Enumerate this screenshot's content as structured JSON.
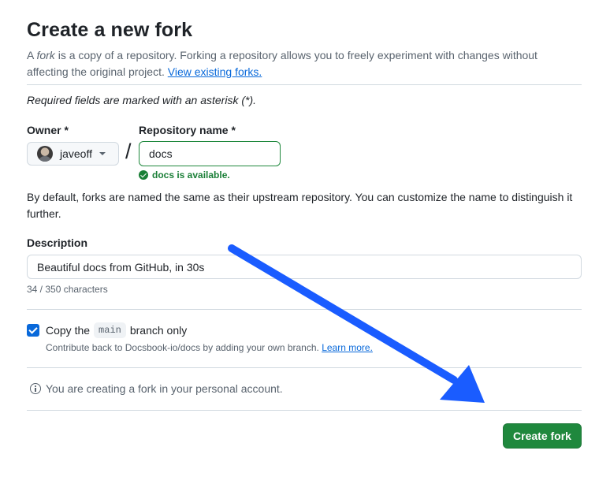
{
  "page": {
    "title": "Create a new fork",
    "intro": {
      "prefix": "A ",
      "fork_word": "fork",
      "text": " is a copy of a repository. Forking a repository allows you to freely experiment with changes without affecting the original project. ",
      "link": "View existing forks."
    },
    "required_note": "Required fields are marked with an asterisk (*)."
  },
  "owner": {
    "label": "Owner *",
    "value": "javeoff"
  },
  "repository": {
    "label": "Repository name *",
    "value": "docs",
    "availability": "docs is available."
  },
  "separator": "/",
  "naming_help": "By default, forks are named the same as their upstream repository. You can customize the name to distinguish it further.",
  "description": {
    "label": "Description",
    "value": "Beautiful docs from GitHub, in 30s",
    "char_count": "34 / 350 characters"
  },
  "copy_branch": {
    "checked": true,
    "label_before": "Copy the",
    "branch": "main",
    "label_after": "branch only",
    "help": "Contribute back to Docsbook-io/docs by adding your own branch. ",
    "help_link": "Learn more."
  },
  "info": "You are creating a fork in your personal account.",
  "submit_label": "Create fork",
  "colors": {
    "primary_button": "#1f883d",
    "link": "#0969da",
    "success": "#1a7f37",
    "annotation_arrow": "#1a5cff"
  },
  "icons": {
    "owner_dropdown": "triangle-down-icon",
    "availability": "check-circle-icon",
    "info": "info-icon",
    "annotation": "arrow-pointer"
  }
}
